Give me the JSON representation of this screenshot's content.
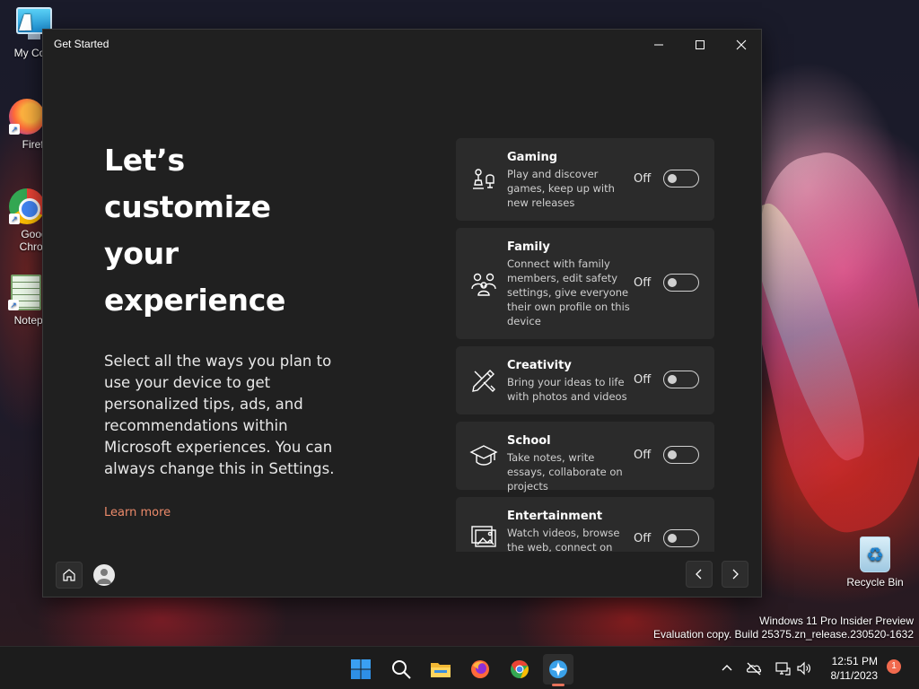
{
  "desktop": {
    "icons": [
      {
        "label": "My Com",
        "icon": "computer-icon"
      },
      {
        "label": "Firefo",
        "icon": "firefox-icon"
      },
      {
        "label": "Goog",
        "label2": "Chron",
        "icon": "chrome-icon"
      },
      {
        "label": "Notepa",
        "icon": "notepad-icon"
      },
      {
        "label": "Recycle Bin",
        "icon": "recycle-bin-icon"
      }
    ],
    "watermark": {
      "line1": "Windows 11 Pro Insider Preview",
      "line2": "Evaluation copy. Build 25375.zn_release.230520-1632"
    }
  },
  "window": {
    "title": "Get Started",
    "controls": {
      "minimize": "minimize-icon",
      "maximize": "maximize-icon",
      "close": "close-icon"
    },
    "headline": [
      "Let’s",
      "customize",
      "your",
      "experience"
    ],
    "body": "Select all the ways you plan to use your device to get personalized tips, ads, and recommendations within Microsoft experiences. You can always change this in Settings.",
    "learn_more": "Learn more",
    "cards": [
      {
        "title": "Gaming",
        "desc": "Play and discover games, keep up with new releases",
        "state": "Off",
        "icon": "gaming-icon"
      },
      {
        "title": "Family",
        "desc": "Connect with family members, edit safety settings, give everyone their own profile on this device",
        "state": "Off",
        "icon": "family-icon"
      },
      {
        "title": "Creativity",
        "desc": "Bring your ideas to life with photos and videos",
        "state": "Off",
        "icon": "creativity-icon"
      },
      {
        "title": "School",
        "desc": "Take notes, write essays, collaborate on projects",
        "state": "Off",
        "icon": "school-icon"
      },
      {
        "title": "Entertainment",
        "desc": "Watch videos, browse the web, connect on",
        "state": "Off",
        "icon": "entertainment-icon"
      }
    ],
    "footer": {
      "home": "home-icon",
      "account": "account-icon",
      "back": "chevron-left-icon",
      "next": "chevron-right-icon"
    }
  },
  "taskbar": {
    "apps": [
      "start-icon",
      "search-icon",
      "file-explorer-icon",
      "firefox-icon",
      "chrome-icon",
      "get-started-icon"
    ],
    "tray": [
      "chevron-up-icon",
      "onedrive-icon",
      "network-icon",
      "volume-icon"
    ],
    "time": "12:51 PM",
    "date": "8/11/2023",
    "notifications": "1"
  },
  "colors": {
    "accent": "#ec8a6a",
    "card": "#2b2b2b",
    "window": "#202020",
    "taskbar": "#1c1c1c"
  }
}
